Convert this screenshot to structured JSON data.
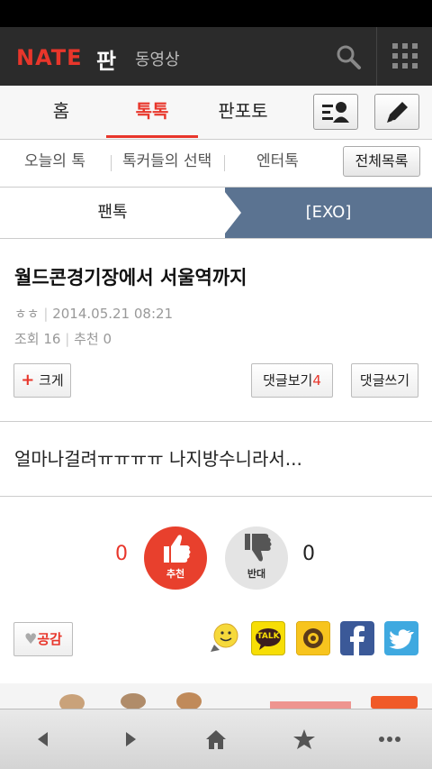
{
  "header": {
    "logo": "NATE",
    "pan": "판",
    "video": "동영상"
  },
  "tabs": [
    {
      "label": "홈"
    },
    {
      "label": "톡톡"
    },
    {
      "label": "판포토"
    }
  ],
  "subnav": {
    "items": [
      "오늘의 톡",
      "톡커들의 선택",
      "엔터톡"
    ],
    "all": "전체목록"
  },
  "breadcrumb": {
    "left": "팬톡",
    "right": "[EXO]"
  },
  "post": {
    "title": "월드콘경기장에서 서울역까지",
    "author": "ㅎㅎ",
    "date": "2014.05.21 08:21",
    "views_label": "조회",
    "views": "16",
    "recommend_label": "추천",
    "recommend": "0",
    "body": "얼마나걸려ㅠㅠㅠㅠ 나지방수니라서..."
  },
  "buttons": {
    "size": "크게",
    "view_comments": "댓글보기",
    "comment_count": "4",
    "write_comment": "댓글쓰기"
  },
  "vote": {
    "up_count": "0",
    "up_label": "추천",
    "down_label": "반대",
    "down_count": "0"
  },
  "share": {
    "empathy": "공감",
    "kakaotalk": "TALK"
  },
  "colors": {
    "brand_red": "#e8362b",
    "header_bg": "#2b2b2b",
    "crumb_blue": "#5b7391",
    "facebook": "#3b5998",
    "twitter": "#3fa9e0"
  }
}
